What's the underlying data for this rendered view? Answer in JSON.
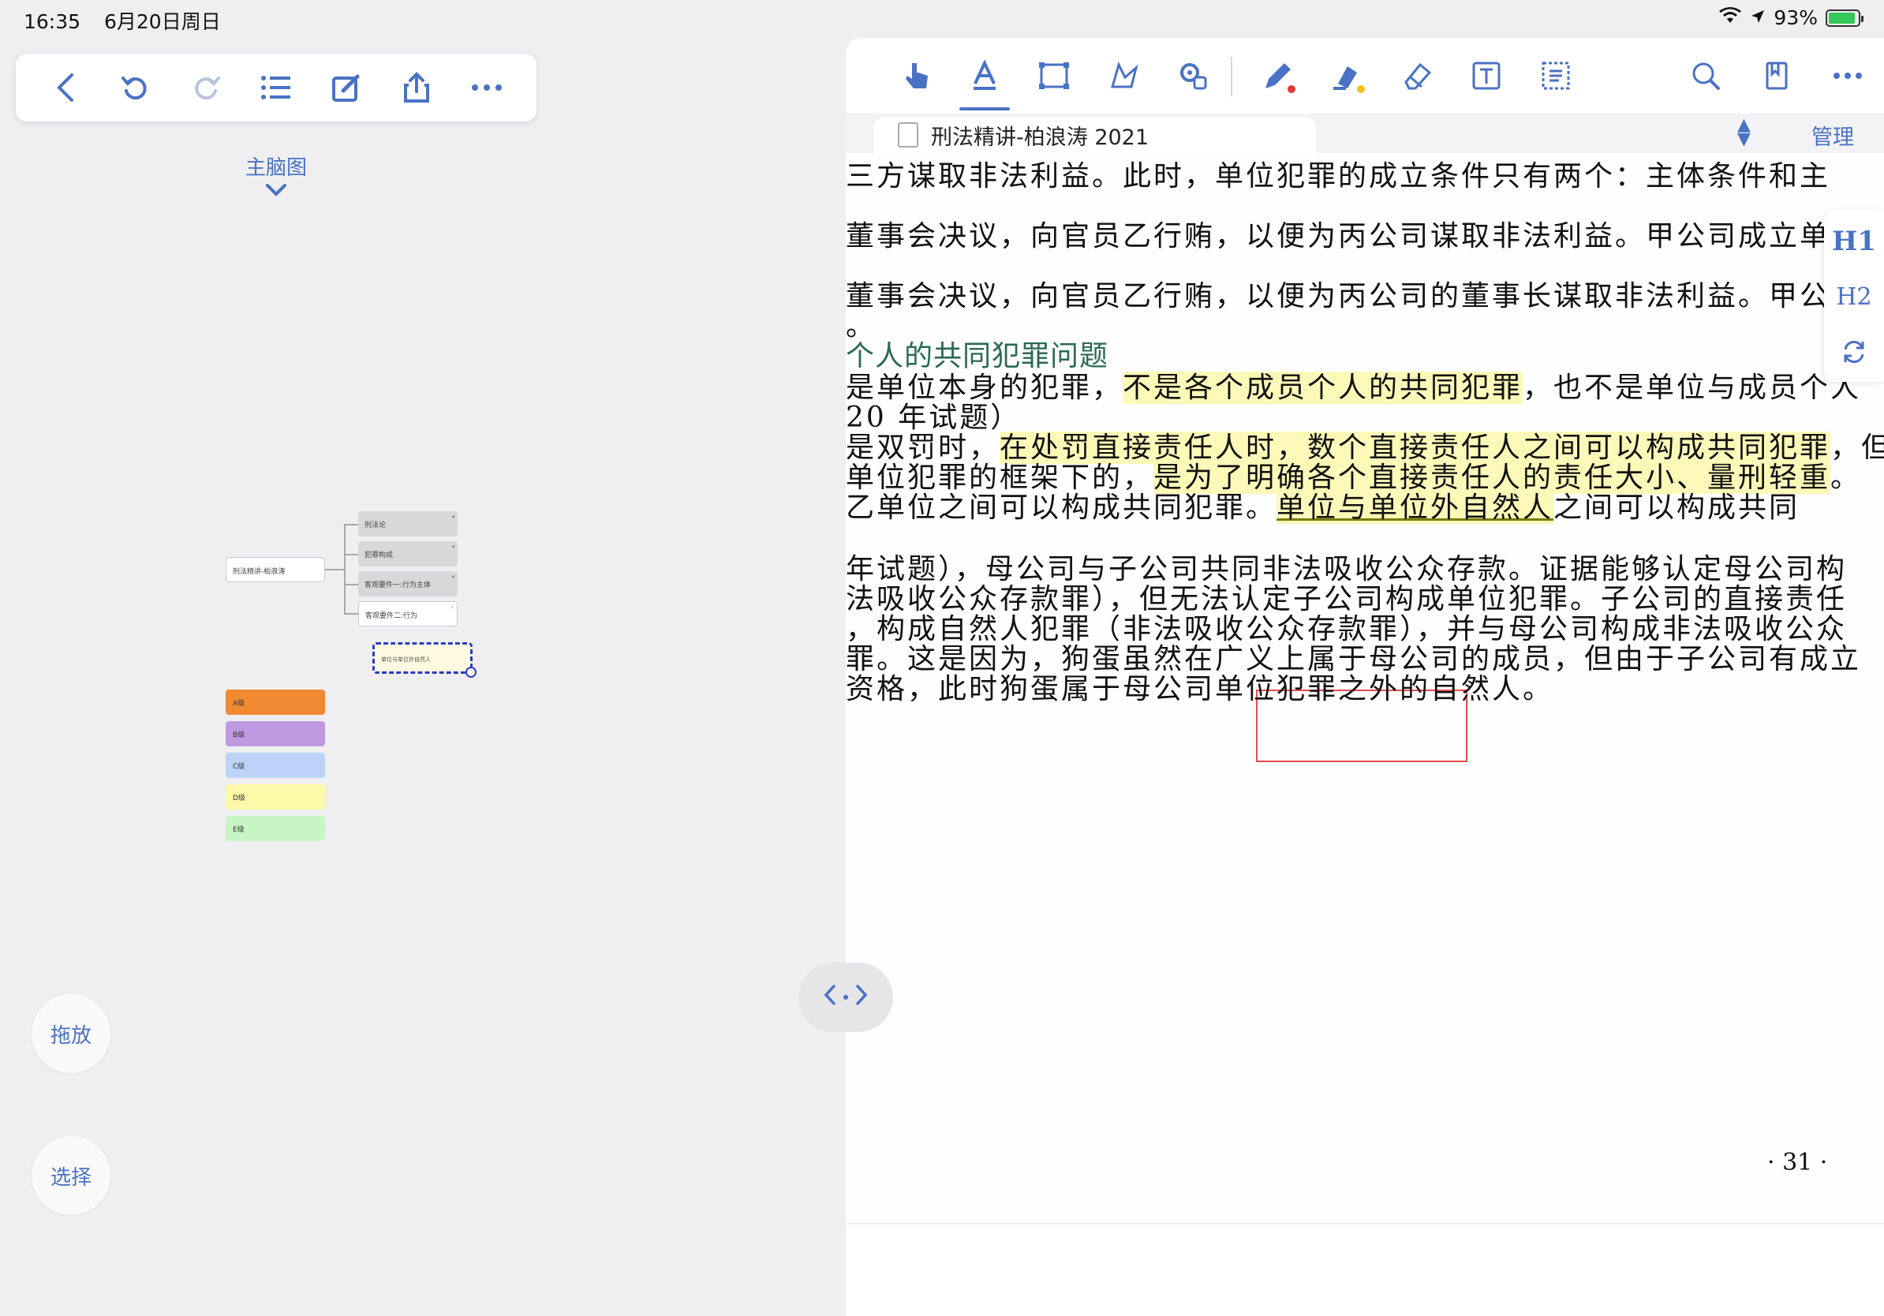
{
  "status": {
    "time": "16:35",
    "date": "6月20日周日",
    "battery": "93%",
    "battery_level": 0.93
  },
  "mindmap_toolbar": {
    "icons": [
      "back-chevron-icon",
      "undo-icon",
      "redo-icon",
      "outline-list-icon",
      "edit-icon",
      "share-icon",
      "more-icon"
    ]
  },
  "mindmap": {
    "title": "主脑图",
    "root": "刑法精讲-柏浪涛",
    "branches": [
      {
        "label": "刑法论",
        "fold": "◂"
      },
      {
        "label": "犯罪构成",
        "fold": "◂"
      },
      {
        "label": "客观要件一:行为主体",
        "fold": "◂"
      },
      {
        "label": "客观要件二:行为",
        "fold": "›"
      }
    ],
    "new_node": "单位与单位外自然人",
    "legend": [
      {
        "label": "A级",
        "color": "#f08a32"
      },
      {
        "label": "B级",
        "color": "#bf9ae0"
      },
      {
        "label": "C级",
        "color": "#bcd3f7"
      },
      {
        "label": "D级",
        "color": "#fdf9a8"
      },
      {
        "label": "E级",
        "color": "#c8f5c4"
      }
    ]
  },
  "buttons": {
    "drag": "拖放",
    "select": "选择"
  },
  "document": {
    "tab_title": "刑法精讲-柏浪涛 2021",
    "manage": "管理",
    "side_buttons": {
      "h1": "H1",
      "h2": "H2"
    },
    "lines": [
      {
        "segments": [
          {
            "t": "三方谋取非法利益。此时，单位犯罪的成立条件只有两个：主体条件和主",
            "h": false
          }
        ]
      },
      {
        "segments": [
          {
            "t": "董事会决议，向官员乙行贿，以便为丙公司谋取非法利益。甲公司成立单",
            "h": false
          }
        ]
      },
      {
        "segments": [
          {
            "t": "董事会决议，向官员乙行贿，以便为丙公司的董事长谋取非法利益。甲公",
            "h": false
          }
        ]
      },
      {
        "segments": [
          {
            "t": "。",
            "h": false
          }
        ]
      },
      {
        "segments": [
          {
            "t": "个人的共同犯罪问题",
            "h": false
          }
        ],
        "heading": true
      },
      {
        "segments": [
          {
            "t": "是单位本身的犯罪，",
            "h": false
          },
          {
            "t": "不是各个成员个人的共同犯罪",
            "h": true
          },
          {
            "t": "，也不是单位与成员个人",
            "h": false
          }
        ]
      },
      {
        "segments": [
          {
            "t": "20 年试题）",
            "h": false
          }
        ]
      },
      {
        "segments": [
          {
            "t": "是双罚时，",
            "h": false
          },
          {
            "t": "在处罚直接责任人时，数个直接责任人之间可以构成共同犯罪",
            "h": true
          },
          {
            "t": "，但",
            "h": false
          }
        ]
      },
      {
        "segments": [
          {
            "t": "单位犯罪的框架下的，",
            "h": false
          },
          {
            "t": "是为了明确各个直接责任人的责任大小、量刑轻重",
            "h": true
          },
          {
            "t": "。",
            "h": false
          }
        ]
      },
      {
        "segments": [
          {
            "t": "乙单位之间可以构成共同犯罪。",
            "h": false
          },
          {
            "t": "单位与单位外自然人",
            "h": true
          },
          {
            "t": "之间可以构成共同",
            "h": false
          }
        ]
      },
      {
        "segments": [
          {
            "t": "年试题），母公司与子公司共同非法吸收公众存款。证据能够认定母公司构",
            "h": false
          }
        ]
      },
      {
        "segments": [
          {
            "t": "法吸收公众存款罪），但无法认定子公司构成单位犯罪。子公司的直接责任",
            "h": false
          }
        ]
      },
      {
        "segments": [
          {
            "t": "，构成自然人犯罪（非法吸收公众存款罪），并与母公司构成非法吸收公众",
            "h": false
          }
        ]
      },
      {
        "segments": [
          {
            "t": "罪。这是因为，狗蛋虽然在广义上属于母公司的成员，但由于子公司有成立",
            "h": false
          }
        ]
      },
      {
        "segments": [
          {
            "t": "资格，此时狗蛋属于母公司单位犯罪之外的自然人。",
            "h": false
          }
        ]
      }
    ],
    "page_number": "· 31 ·"
  }
}
